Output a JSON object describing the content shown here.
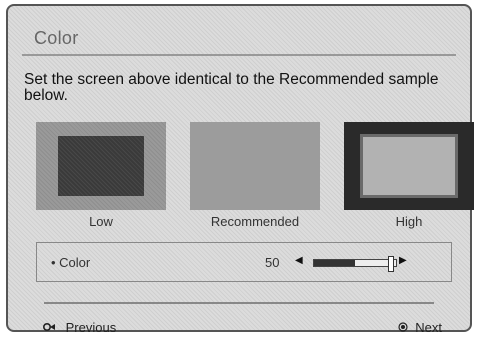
{
  "screen": {
    "title": "Color",
    "instruction": "Set the screen above identical to the Recommended sample below."
  },
  "samples": [
    {
      "label": "Low"
    },
    {
      "label": "Recommended"
    },
    {
      "label": "High"
    }
  ],
  "control": {
    "label": "• Color",
    "value": "50",
    "slider_level": 0.5
  },
  "nav": {
    "previous_label": "Previous",
    "previous_icon": "back-return-icon",
    "next_label": "Next",
    "next_icon": "ok-button-icon"
  }
}
